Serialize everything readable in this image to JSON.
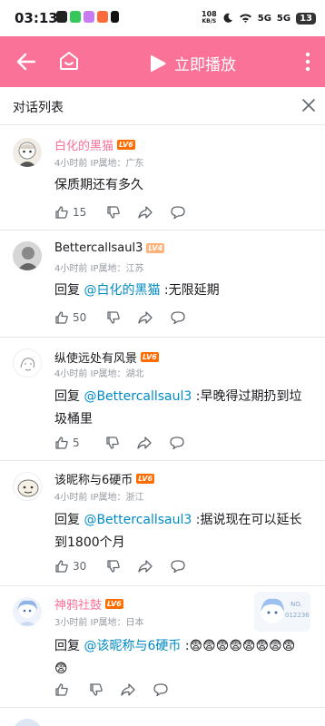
{
  "status_bar": {
    "time": "03:13",
    "net_speed_value": "108",
    "net_speed_unit": "KB/S",
    "signal1": "5G",
    "signal2": "5G",
    "battery": "13"
  },
  "toolbar": {
    "play_label": "立即播放",
    "accent_color": "#fb7299"
  },
  "panel": {
    "title": "对话列表"
  },
  "comments": [
    {
      "name": "白化的黑猫",
      "level": "LV6",
      "vip": true,
      "meta": "4小时前  IP属地：广东",
      "text": "保质期还有多久",
      "likes": "15"
    },
    {
      "name": "Bettercallsaul3",
      "level": "LV4",
      "vip": false,
      "meta": "4小时前  IP属地：江苏",
      "reply_prefix": "回复 ",
      "mention": "@白化的黑猫",
      "text": " :无限延期",
      "likes": "50"
    },
    {
      "name": "纵使远处有风景",
      "level": "LV6",
      "vip": false,
      "meta": "4小时前  IP属地：湖北",
      "reply_prefix": "回复 ",
      "mention": "@Bettercallsaul3",
      "text": " :早晚得过期扔到垃圾桶里",
      "likes": "5"
    },
    {
      "name": "该昵称与6硬币",
      "level": "LV6",
      "vip": false,
      "meta": "4小时前  IP属地：浙江",
      "reply_prefix": "回复 ",
      "mention": "@Bettercallsaul3",
      "text": " :据说现在可以延长到1800个月",
      "likes": "30"
    },
    {
      "name": "神鸦社鼓",
      "level": "LV6",
      "vip": true,
      "meta": "3小时前  IP属地：日本",
      "reply_prefix": "回复 ",
      "mention": "@该昵称与6硬币",
      "text": " :😨😨😨😨😨😨😨😨😨",
      "likes": "",
      "badge_text": "NO.",
      "badge_number": "012236"
    }
  ]
}
